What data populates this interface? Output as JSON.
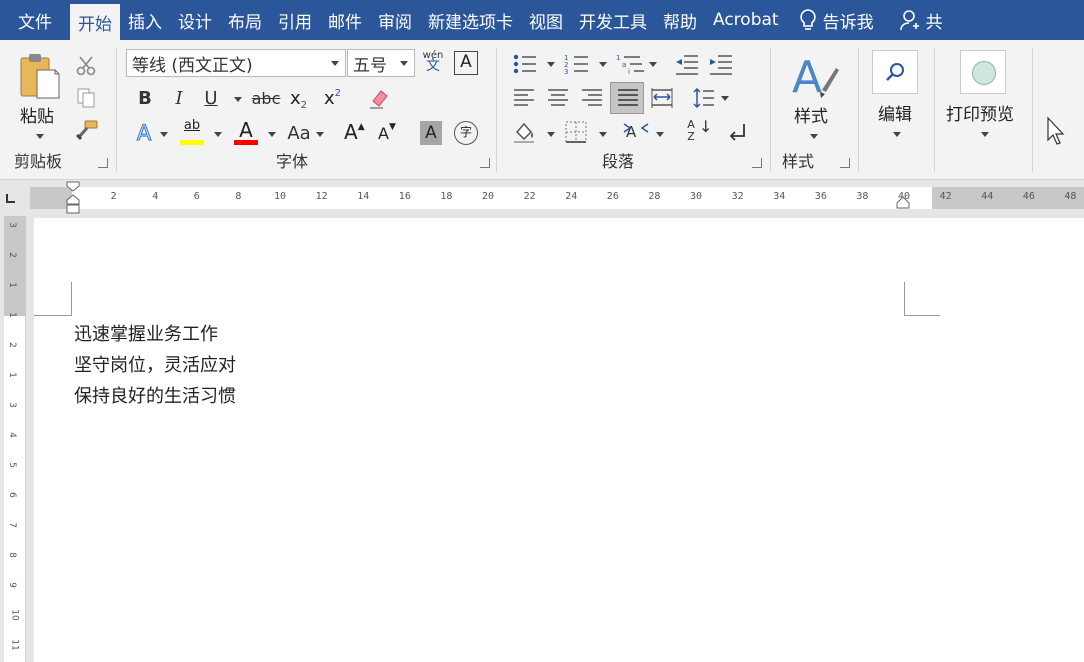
{
  "menu": {
    "file": "文件",
    "home": "开始",
    "insert": "插入",
    "design": "设计",
    "layout": "布局",
    "references": "引用",
    "mailings": "邮件",
    "review": "审阅",
    "new_tab": "新建选项卡",
    "view": "视图",
    "developer": "开发工具",
    "help": "帮助",
    "acrobat": "Acrobat",
    "tell_me": "告诉我",
    "share": "共"
  },
  "ribbon": {
    "clipboard": {
      "paste_label": "粘贴",
      "group_label": "剪贴板"
    },
    "font": {
      "font_name": "等线 (西文正文)",
      "font_size": "五号",
      "phonetic_top": "wén",
      "phonetic_bottom": "文",
      "border_char": "A",
      "bold": "B",
      "italic": "I",
      "underline": "U",
      "strike": "abc",
      "subscript_base": "x",
      "subscript_mark": "2",
      "superscript_base": "x",
      "superscript_mark": "2",
      "text_effects": "A",
      "highlight": "ab",
      "font_color": "A",
      "change_case": "Aa",
      "grow": "A",
      "shrink": "A",
      "char_shading": "A",
      "enclose_char": "字",
      "group_label": "字体"
    },
    "paragraph": {
      "group_label": "段落",
      "sort_label": "AZ"
    },
    "styles": {
      "button_label": "样式",
      "group_label": "样式"
    },
    "editing": {
      "button_label": "编辑"
    },
    "print_preview": {
      "button_label": "打印预览"
    }
  },
  "ruler": {
    "numbers": [
      "2",
      "4",
      "6",
      "8",
      "10",
      "12",
      "14",
      "16",
      "18",
      "20",
      "22",
      "24",
      "26",
      "28",
      "30",
      "32",
      "34",
      "36",
      "38",
      "40",
      "42",
      "44",
      "46",
      "48"
    ]
  },
  "vruler": {
    "numbers": [
      "3",
      "2",
      "1",
      "1",
      "2",
      "1",
      "3",
      "4",
      "5",
      "6",
      "7",
      "8",
      "9",
      "10",
      "11"
    ]
  },
  "document": {
    "lines": [
      "迅速掌握业务工作",
      "坚守岗位，灵活应对",
      "保持良好的生活习惯"
    ]
  },
  "colors": {
    "menubar": "#2b579a",
    "highlight_bar": "#ffff00",
    "font_color_bar": "#ff0000",
    "accent_blue": "#4a86c8"
  }
}
